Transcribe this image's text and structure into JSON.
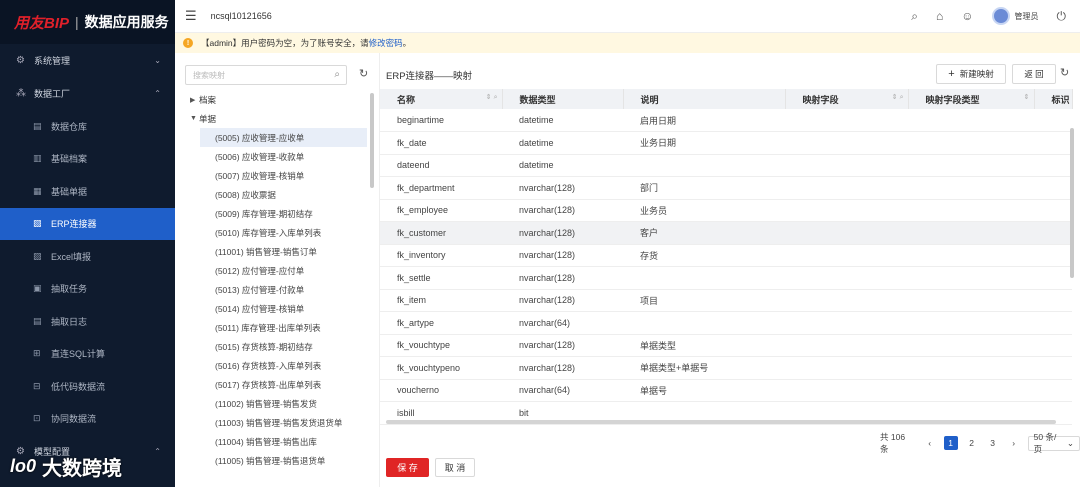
{
  "app": {
    "brand": "用友BIP",
    "separator": "|",
    "product": "数据应用服务"
  },
  "sidebar": {
    "groups": [
      {
        "label": "系统管理",
        "icon": "gear-icon",
        "expanded": false
      },
      {
        "label": "数据工厂",
        "icon": "cluster-icon",
        "expanded": true
      }
    ],
    "items": [
      {
        "label": "数据仓库",
        "icon": "warehouse-icon"
      },
      {
        "label": "基础档案",
        "icon": "archive-icon"
      },
      {
        "label": "基础单据",
        "icon": "document-icon"
      },
      {
        "label": "ERP连接器",
        "icon": "connector-icon",
        "active": true
      },
      {
        "label": "Excel填报",
        "icon": "excel-icon"
      },
      {
        "label": "抽取任务",
        "icon": "task-icon"
      },
      {
        "label": "抽取日志",
        "icon": "log-icon"
      },
      {
        "label": "直连SQL计算",
        "icon": "sql-icon"
      },
      {
        "label": "低代码数据流",
        "icon": "flow-icon"
      },
      {
        "label": "协同数据流",
        "icon": "collab-icon"
      }
    ],
    "bottom_group": {
      "label": "模型配置",
      "icon": "model-icon"
    },
    "watermark": "大数跨境",
    "watermark_logo": "lo0"
  },
  "topbar": {
    "db_name": "ncsql10121656",
    "user_name": "管理员"
  },
  "notice": {
    "text": "【admin】用户密码为空，为了账号安全，请",
    "link": "修改密码",
    "end": "。"
  },
  "tree": {
    "search_placeholder": "搜索映射",
    "nodes": [
      {
        "label": "档案",
        "expanded": false
      },
      {
        "label": "单据",
        "expanded": true
      }
    ],
    "leaves": [
      "(5005) 应收管理-应收单",
      "(5006) 应收管理-收款单",
      "(5007) 应收管理-核销单",
      "(5008) 应收票据",
      "(5009) 库存管理-期初结存",
      "(5010) 库存管理-入库单列表",
      "(11001) 销售管理-销售订单",
      "(5012) 应付管理-应付单",
      "(5013) 应付管理-付款单",
      "(5014) 应付管理-核销单",
      "(5011) 库存管理-出库单列表",
      "(5015) 存货核算-期初结存",
      "(5016) 存货核算-入库单列表",
      "(5017) 存货核算-出库单列表",
      "(11002) 销售管理-销售发货",
      "(11003) 销售管理-销售发货退货单",
      "(11004) 销售管理-销售出库",
      "(11005) 销售管理-销售退货单"
    ],
    "selected_index": 0
  },
  "main": {
    "title": "ERP连接器——映射",
    "new_button": "新建映射",
    "new_icon": "+",
    "back_button": "返 回",
    "columns": [
      "名称",
      "数据类型",
      "说明",
      "映射字段",
      "映射字段类型",
      "标识"
    ],
    "rows": [
      [
        "beginartime",
        "datetime",
        "启用日期"
      ],
      [
        "fk_date",
        "datetime",
        "业务日期"
      ],
      [
        "dateend",
        "datetime",
        ""
      ],
      [
        "fk_department",
        "nvarchar(128)",
        "部门"
      ],
      [
        "fk_employee",
        "nvarchar(128)",
        "业务员"
      ],
      [
        "fk_customer",
        "nvarchar(128)",
        "客户"
      ],
      [
        "fk_inventory",
        "nvarchar(128)",
        "存货"
      ],
      [
        "fk_settle",
        "nvarchar(128)",
        ""
      ],
      [
        "fk_item",
        "nvarchar(128)",
        "项目"
      ],
      [
        "fk_artype",
        "nvarchar(64)",
        ""
      ],
      [
        "fk_vouchtype",
        "nvarchar(128)",
        "单据类型"
      ],
      [
        "fk_vouchtypeno",
        "nvarchar(128)",
        "单据类型+单据号"
      ],
      [
        "voucherno",
        "nvarchar(64)",
        "单据号"
      ],
      [
        "isbill",
        "bit",
        ""
      ]
    ],
    "highlighted_row": 5,
    "pagination": {
      "total": "共 106 条",
      "pages": [
        "1",
        "2",
        "3"
      ],
      "current": "1",
      "page_size": "50 条/页"
    },
    "save_button": "保 存",
    "cancel_button": "取 消"
  },
  "colors": {
    "sidebar_bg": "#0f1b2e",
    "active": "#1f5fc9",
    "brand_red": "#e0202a",
    "save_red": "#e02525",
    "notice_bg": "#fff8e1"
  }
}
